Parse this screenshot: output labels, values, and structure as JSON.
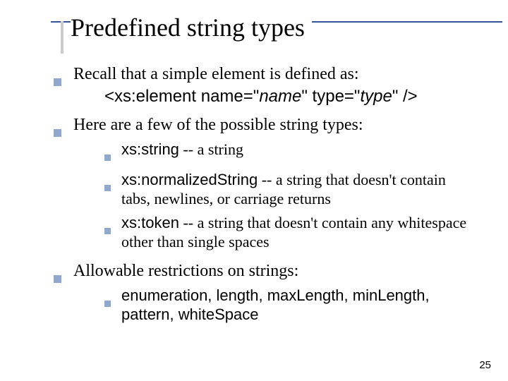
{
  "title": "Predefined string types",
  "recall_line": "Recall that a simple element is defined as:",
  "code": {
    "lt": "<",
    "xs_el": "xs:element  name=\"",
    "name_it": "name",
    "mid": "\"  type=\"",
    "type_it": "type",
    "end": "\" />"
  },
  "few_line": "Here are a few of the possible string types:",
  "types": [
    {
      "code": "xs:string",
      "desc": " -- a string"
    },
    {
      "code": "xs:normalizedString",
      "desc": " -- a string that doesn't contain tabs, newlines, or carriage returns"
    },
    {
      "code": "xs:token",
      "desc": " -- a string that doesn't contain any whitespace other than single spaces"
    }
  ],
  "restrict_line": "Allowable restrictions on strings:",
  "restrictions": " enumeration, length, maxLength, minLength, pattern, whiteSpace",
  "page_number": "25"
}
